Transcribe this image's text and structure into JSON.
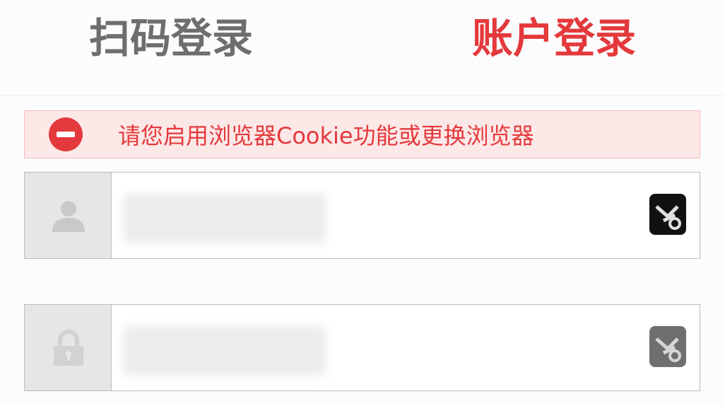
{
  "tabs": {
    "qr_login": "扫码登录",
    "account_login": "账户登录"
  },
  "alert": {
    "icon": "minus-circle-icon",
    "message": "请您启用浏览器Cookie功能或更换浏览器",
    "color": "#e4393c"
  },
  "fields": {
    "username": {
      "icon": "user-icon",
      "value": ""
    },
    "password": {
      "icon": "lock-icon",
      "value": ""
    }
  },
  "colors": {
    "accent": "#e4393c",
    "alert_bg": "#fde8e8",
    "inactive_tab": "#6e6e6e"
  }
}
